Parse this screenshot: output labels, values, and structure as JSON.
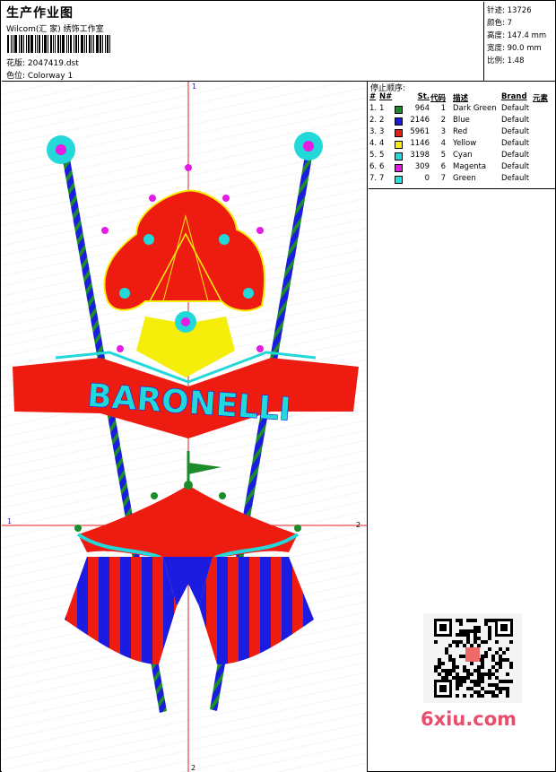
{
  "header": {
    "title": "生产作业图",
    "studio": "Wilcom(汇 家) 绣饰工作室",
    "pattern": "花版: 2047419.dst",
    "colorway": "色位: Colorway 1"
  },
  "stats": {
    "stitches": "针迹: 13726",
    "colors": "颜色: 7",
    "height": "高度: 147.4 mm",
    "width": "宽度: 90.0 mm",
    "scale": "比例: 1.48"
  },
  "axes": {
    "top_label": "1",
    "bottom_label": "2",
    "left_label": "1",
    "right_label": "2"
  },
  "design": {
    "banner_text": "BARONELLI"
  },
  "stop_sequence": {
    "title": "停止顺序:",
    "headers": {
      "idx": "#",
      "n": "N#",
      "st": "St.",
      "code": "代码",
      "desc": "描述",
      "brand": "Brand",
      "element": "元素"
    },
    "rows": [
      {
        "idx": "1.",
        "n": "1",
        "color": "#1a8c2a",
        "st": "964",
        "code": "1",
        "desc": "Dark Green",
        "brand": "Default"
      },
      {
        "idx": "2.",
        "n": "2",
        "color": "#1c1ce0",
        "st": "2146",
        "code": "2",
        "desc": "Blue",
        "brand": "Default"
      },
      {
        "idx": "3.",
        "n": "3",
        "color": "#ee1c10",
        "st": "5961",
        "code": "3",
        "desc": "Red",
        "brand": "Default"
      },
      {
        "idx": "4.",
        "n": "4",
        "color": "#f5ee0a",
        "st": "1146",
        "code": "4",
        "desc": "Yellow",
        "brand": "Default"
      },
      {
        "idx": "5.",
        "n": "5",
        "color": "#22d8d8",
        "st": "3198",
        "code": "5",
        "desc": "Cyan",
        "brand": "Default"
      },
      {
        "idx": "6.",
        "n": "6",
        "color": "#e41ce4",
        "st": "309",
        "code": "6",
        "desc": "Magenta",
        "brand": "Default"
      },
      {
        "idx": "7.",
        "n": "7",
        "color": "#22e0e0",
        "st": "0",
        "code": "7",
        "desc": "Green",
        "brand": "Default"
      }
    ]
  },
  "watermark": "6xiu.com"
}
